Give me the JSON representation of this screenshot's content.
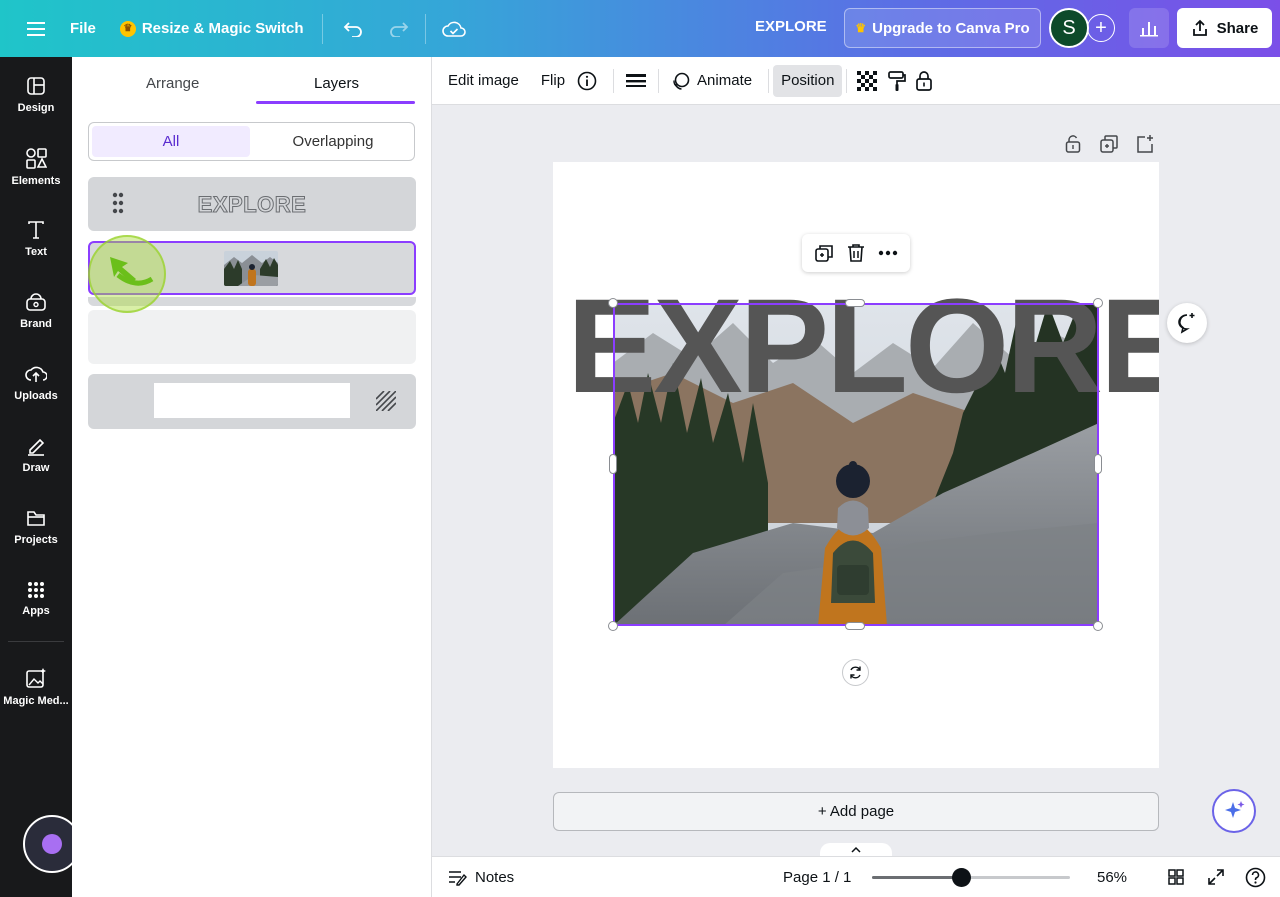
{
  "topbar": {
    "file_label": "File",
    "resize_label": "Resize & Magic Switch",
    "document_title": "EXPLORE",
    "upgrade_label": "Upgrade to Canva Pro",
    "avatar_initial": "S",
    "share_label": "Share"
  },
  "rail": {
    "items": [
      {
        "label": "Design",
        "icon": "design-icon"
      },
      {
        "label": "Elements",
        "icon": "elements-icon"
      },
      {
        "label": "Text",
        "icon": "text-icon"
      },
      {
        "label": "Brand",
        "icon": "brand-icon"
      },
      {
        "label": "Uploads",
        "icon": "uploads-icon"
      },
      {
        "label": "Draw",
        "icon": "draw-icon"
      },
      {
        "label": "Projects",
        "icon": "projects-icon"
      },
      {
        "label": "Apps",
        "icon": "apps-icon"
      },
      {
        "label": "Magic Med...",
        "icon": "magic-media-icon"
      }
    ]
  },
  "panel": {
    "tabs": [
      {
        "label": "Arrange",
        "active": false
      },
      {
        "label": "Layers",
        "active": true
      }
    ],
    "filters": {
      "all": "All",
      "overlapping": "Overlapping"
    },
    "layers": [
      {
        "type": "text",
        "label": "EXPLORE"
      },
      {
        "type": "image",
        "selected": true
      },
      {
        "type": "blank"
      },
      {
        "type": "background"
      }
    ]
  },
  "toolbar": {
    "edit_image": "Edit image",
    "flip": "Flip",
    "animate": "Animate",
    "position": "Position"
  },
  "canvas": {
    "headline": "EXPLORE",
    "add_page": "+ Add page"
  },
  "footer": {
    "notes": "Notes",
    "page_indicator": "Page 1 / 1",
    "zoom": "56%",
    "zoom_fraction": 0.45
  },
  "colors": {
    "accent": "#8b3dff",
    "headline": "#555555",
    "rail_bg": "#18191b"
  }
}
